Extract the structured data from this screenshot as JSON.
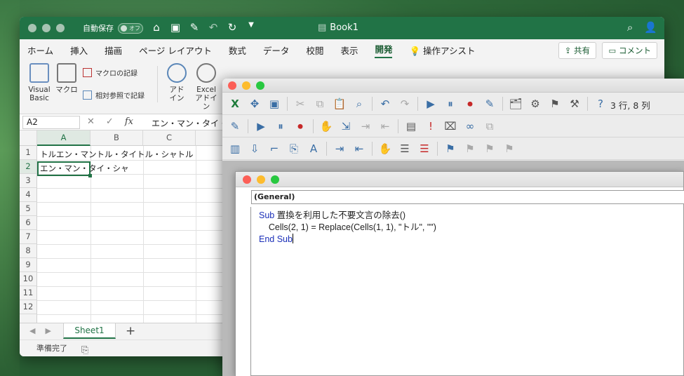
{
  "excel": {
    "autosave_label": "自動保存",
    "autosave_toggle": "オフ",
    "doc_title": "Book1",
    "tabs": [
      "ホーム",
      "挿入",
      "描画",
      "ページ レイアウト",
      "数式",
      "データ",
      "校閲",
      "表示",
      "開発",
      "操作アシスト"
    ],
    "active_tab": "開発",
    "share_label": "共有",
    "comment_label": "コメント",
    "ribbon": {
      "visual_basic": "Visual\nBasic",
      "macro": "マクロ",
      "record_macro": "マクロの記録",
      "relative_ref": "相対参照で記録",
      "addin": "アド\nイン",
      "excel_addin": "Excel\nアドイン"
    },
    "namebox": "A2",
    "formula_value": "エン・マン・タイ・シャ",
    "columns": [
      "A",
      "B",
      "C"
    ],
    "rows": [
      "1",
      "2",
      "3",
      "4",
      "5",
      "6",
      "7",
      "8",
      "9",
      "10",
      "11",
      "12"
    ],
    "cells": {
      "A1": "トルエン・マントル・タイトル・シャトル",
      "A2": "エン・マン・タイ・シャ"
    },
    "sheet_tab": "Sheet1",
    "status": "準備完了"
  },
  "vbe": {
    "cursor_position": "3 行, 8 列",
    "object_combo": "(General)",
    "code_lines": [
      {
        "kw": "Sub",
        "text": " 置換を利用した不要文言の除去()"
      },
      {
        "kw": "",
        "text": "    Cells(2, 1) = Replace(Cells(1, 1), \"トル\", \"\")"
      },
      {
        "kw": "End Sub",
        "text": ""
      }
    ]
  },
  "colors": {
    "excel_green": "#217346",
    "keyword_blue": "#1b2fb8"
  }
}
